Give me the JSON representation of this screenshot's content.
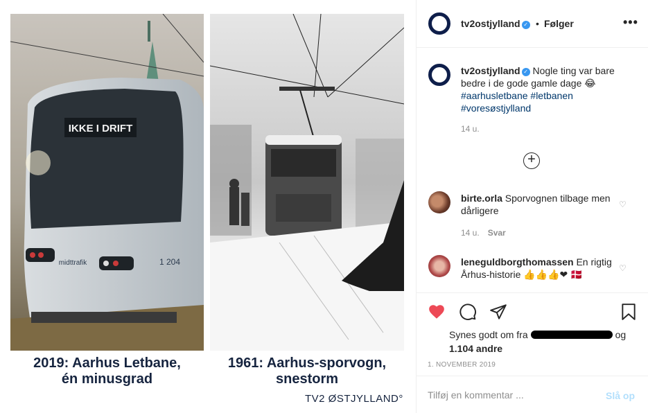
{
  "post_image": {
    "left_photo_sign": "IKKE I DRIFT",
    "left_photo_fleet": "1 204",
    "left_photo_logo": "midttrafik",
    "left_caption_line1": "2019: Aarhus Letbane,",
    "left_caption_line2": "én minusgrad",
    "right_caption_line1": "1961: Aarhus-sporvogn,",
    "right_caption_line2": "snestorm",
    "brand": "TV2 ØSTJYLLAND°"
  },
  "header": {
    "username": "tv2ostjylland",
    "separator": "•",
    "follow_label": "Følger",
    "more_label": "•••",
    "verified_mark": "✓"
  },
  "caption": {
    "username": "tv2ostjylland",
    "text": "Nogle ting var bare bedre i de gode gamle dage 😂",
    "hashtags": "#aarhusletbane #letbanen #voresøstjylland",
    "time": "14 u."
  },
  "load_more_label": "+",
  "comments": [
    {
      "username": "birte.orla",
      "text": "Sporvognen tilbage men dårligere",
      "time": "14 u.",
      "reply_label": "Svar"
    },
    {
      "username": "leneguldborgthomassen",
      "text": "En rigtig Århus-historie 👍👍👍❤ 🇩🇰"
    }
  ],
  "likes": {
    "prefix": "Synes godt om fra",
    "suffix": "og",
    "count_line": "1.104 andre"
  },
  "date": "1. NOVEMBER 2019",
  "add_comment": {
    "placeholder": "Tilføj en kommentar ...",
    "post_label": "Slå op"
  },
  "colors": {
    "like_red": "#ed4956",
    "link_blue": "#3897f0",
    "hashtag": "#00376b",
    "brand_navy": "#0e1e4a"
  }
}
